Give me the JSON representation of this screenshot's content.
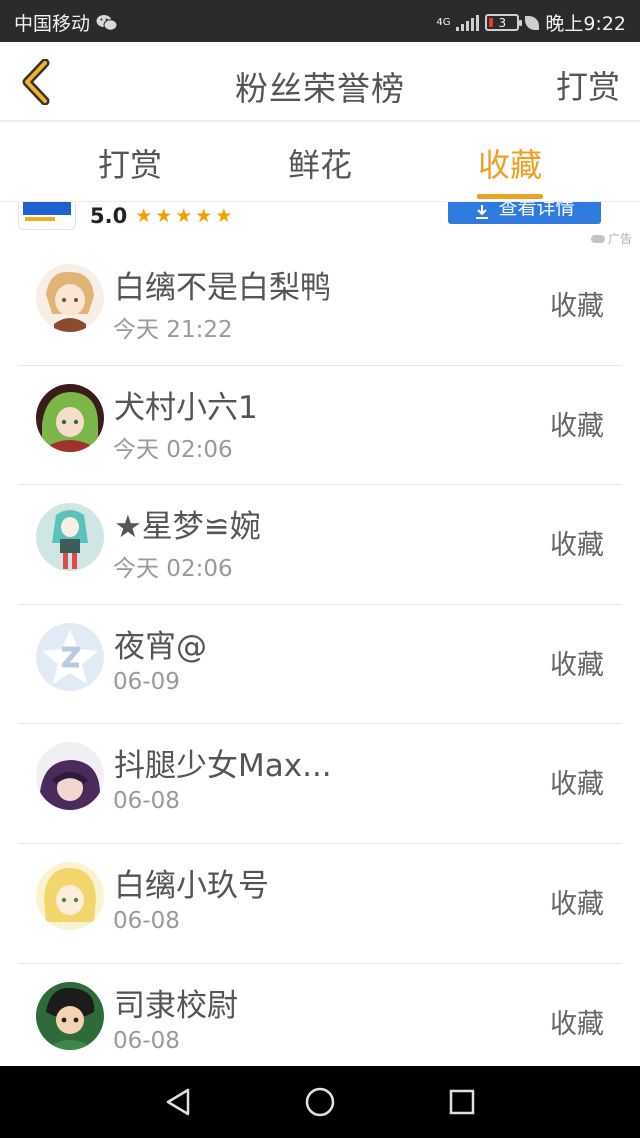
{
  "status_bar": {
    "carrier": "中国移动",
    "network": "4G",
    "battery_level": "3",
    "time": "晚上9:22",
    "wechat_icon": "wechat-icon",
    "leaf_icon": "leaf-icon"
  },
  "header": {
    "back_icon": "chevron-left-icon",
    "title": "粉丝荣誉榜",
    "action": "打赏"
  },
  "tabs": [
    {
      "label": "打赏",
      "active": false
    },
    {
      "label": "鲜花",
      "active": false
    },
    {
      "label": "收藏",
      "active": true
    }
  ],
  "ad": {
    "rating": "5.0",
    "stars": "★★★★★",
    "button": "查看详情",
    "tag": "广告"
  },
  "list": [
    {
      "name": "白缡不是白梨鸭",
      "time": "今天 21:22",
      "action": "收藏",
      "avatar_color": "#e9c79a"
    },
    {
      "name": "犬村小六1",
      "time": "今天 02:06",
      "action": "收藏",
      "avatar_color": "#8e3b33"
    },
    {
      "name": "★星梦≌婉",
      "time": "今天 02:06",
      "action": "收藏",
      "avatar_color": "#6fc4c0"
    },
    {
      "name": "夜宵@",
      "time": "06-09",
      "action": "收藏",
      "avatar_color": "#dbe6f3"
    },
    {
      "name": "抖腿少女Max...",
      "time": "06-08",
      "action": "收藏",
      "avatar_color": "#5b3a6e"
    },
    {
      "name": "白缡小玖号",
      "time": "06-08",
      "action": "收藏",
      "avatar_color": "#f2d77a"
    },
    {
      "name": "司隶校尉",
      "time": "06-08",
      "action": "收藏",
      "avatar_color": "#2f6a3a"
    }
  ],
  "nav_bar": {
    "back_icon": "triangle-back-icon",
    "home_icon": "circle-home-icon",
    "recents_icon": "square-recents-icon"
  },
  "colors": {
    "accent": "#f0a020",
    "text": "#555555",
    "subtext": "#9a9a9a",
    "ad_button": "#2f7be0"
  }
}
